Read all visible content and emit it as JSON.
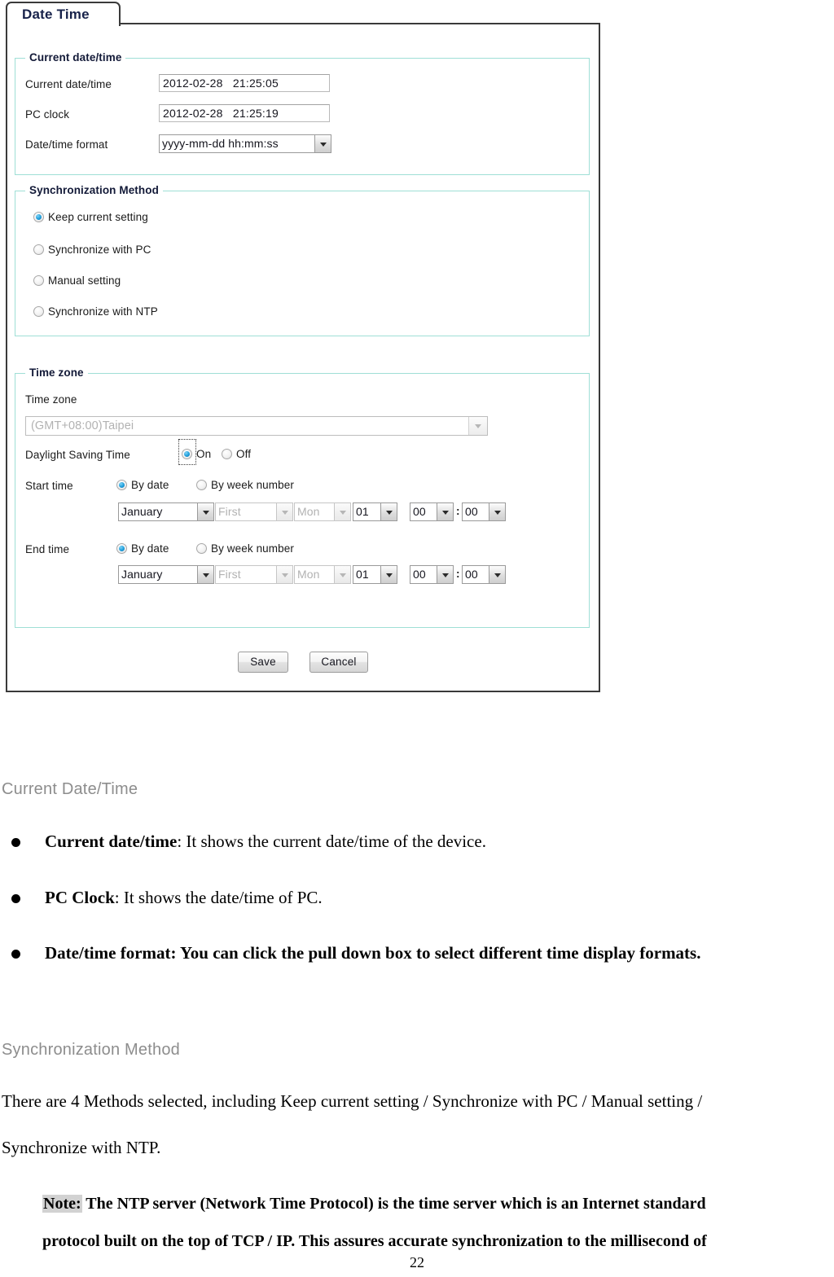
{
  "screenshot": {
    "tab_label": "Date Time",
    "current_section": {
      "legend": "Current date/time",
      "rows": [
        {
          "label": "Current date/time",
          "value": "2012-02-28   21:25:05"
        },
        {
          "label": "PC clock",
          "value": "2012-02-28   21:25:19"
        }
      ],
      "format_label": "Date/time format",
      "format_value": "yyyy-mm-dd hh:mm:ss"
    },
    "sync_section": {
      "legend": "Synchronization Method",
      "options": [
        {
          "label": "Keep current setting",
          "selected": true
        },
        {
          "label": "Synchronize with PC",
          "selected": false
        },
        {
          "label": "Manual setting",
          "selected": false
        },
        {
          "label": "Synchronize with NTP",
          "selected": false
        }
      ]
    },
    "timezone_section": {
      "legend": "Time zone",
      "tz_label": "Time zone",
      "tz_value": "(GMT+08:00)Taipei",
      "dst_label": "Daylight Saving Time",
      "dst_on_label": "On",
      "dst_off_label": "Off",
      "start_label": "Start time",
      "end_label": "End time",
      "by_date_label": "By date",
      "by_week_label": "By week number",
      "start_row": {
        "month": "January",
        "week": "First",
        "day": "Mon",
        "date": "01",
        "hour": "00",
        "minute": "00",
        "colon": ":"
      },
      "end_row": {
        "month": "January",
        "week": "First",
        "day": "Mon",
        "date": "01",
        "hour": "00",
        "minute": "00",
        "colon": ":"
      }
    },
    "buttons": {
      "save": "Save",
      "cancel": "Cancel"
    }
  },
  "document": {
    "heading_current": "Current Date/Time",
    "heading_sync": "Synchronization Method",
    "bullets": [
      {
        "bold": "Current date/time",
        "rest": ": It shows the current date/time of the device.",
        "all_bold": false
      },
      {
        "bold": "PC Clock",
        "rest": ": It shows the date/time of PC.",
        "all_bold": false
      },
      {
        "bold": "Date/time format: You can click the pull down box to select different time display formats.",
        "rest": "",
        "all_bold": true
      }
    ],
    "sync_para_line1": "There are 4 Methods selected, including Keep current setting / Synchronize with PC / Manual setting /",
    "sync_para_line2": "Synchronize with NTP.",
    "note_tag": "Note:",
    "note_line1": " The NTP server (Network Time Protocol) is the time server which is an Internet standard",
    "note_line2": "protocol built on the top of TCP / IP. This assures accurate synchronization to the millisecond of",
    "page_number": "22"
  }
}
